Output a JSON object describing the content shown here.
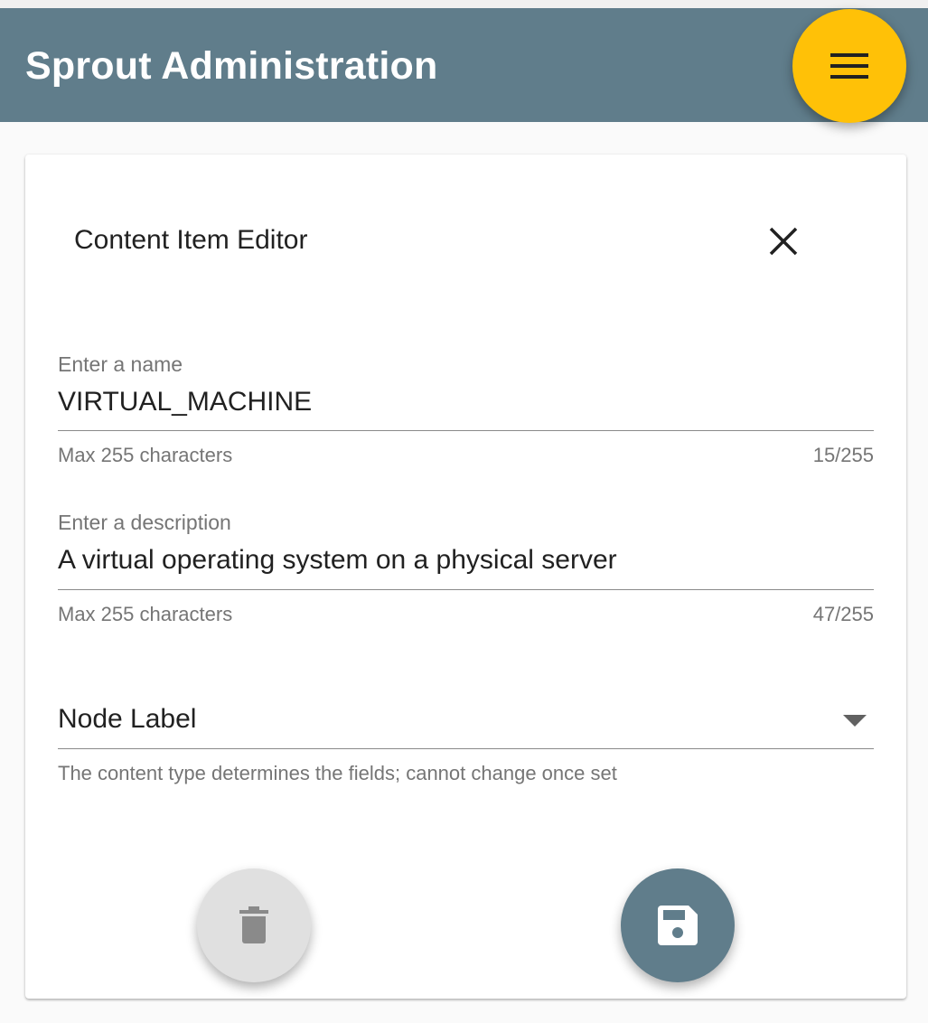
{
  "app": {
    "title": "Sprout Administration",
    "menu_icon": "menu-icon"
  },
  "editor": {
    "title": "Content Item Editor",
    "close_icon": "close-icon",
    "fields": [
      {
        "label": "Enter a name",
        "value": "VIRTUAL_MACHINE",
        "hint": "Max 255 characters",
        "counter": "15/255"
      },
      {
        "label": "Enter a description",
        "value": "A virtual operating system on a physical server",
        "hint": "Max 255 characters",
        "counter": "47/255"
      }
    ],
    "select": {
      "value": "Node Label",
      "hint": "The content type determines the fields; cannot change once set",
      "arrow_icon": "dropdown-arrow-icon"
    },
    "actions": {
      "delete_icon": "trash-icon",
      "save_icon": "save-icon"
    }
  },
  "colors": {
    "primary": "#607d8b",
    "accent": "#ffc107",
    "disabled_fab": "#e0e0e0"
  }
}
